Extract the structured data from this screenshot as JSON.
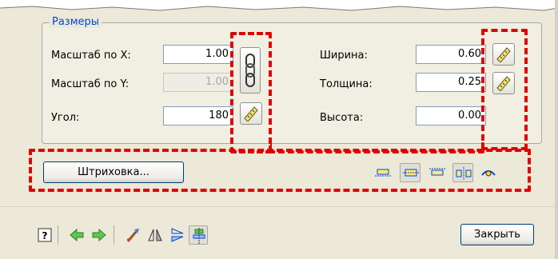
{
  "group": {
    "title": "Размеры"
  },
  "fields": {
    "scale_x": {
      "label": "Масштаб по X:",
      "value": "1.00"
    },
    "scale_y": {
      "label": "Масштаб по Y:",
      "value": "1.00"
    },
    "angle": {
      "label": "Угол:",
      "value": "180"
    },
    "width": {
      "label": "Ширина:",
      "value": "0.60"
    },
    "thickness": {
      "label": "Толщина:",
      "value": "0.25"
    },
    "height": {
      "label": "Высота:",
      "value": "0.00"
    }
  },
  "buttons": {
    "hatch_label": "Штриховка...",
    "close_label": "Закрыть"
  },
  "icons": {
    "lock_ratio": "chain-link-icon",
    "measure": "ruler-icon",
    "align": [
      "align-bottom-icon",
      "align-center-icon",
      "align-top-icon",
      "split-align-icon",
      "eye-preview-icon"
    ],
    "toolbar": [
      "help-icon",
      "arrow-left-icon",
      "arrow-right-icon",
      "paint-brush-icon",
      "mirror-vertical-icon",
      "mirror-horizontal-icon",
      "align-objects-icon"
    ]
  },
  "colors": {
    "highlight": "#E00000",
    "group_title": "#0046D5"
  }
}
